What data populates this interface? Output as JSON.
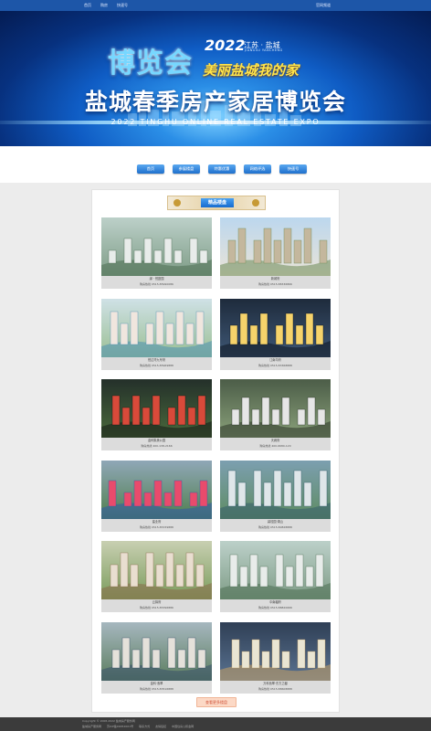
{
  "topbar": {
    "nav": [
      "首页",
      "购房",
      "快速号"
    ],
    "right_link": "官网频道"
  },
  "banner": {
    "expo_word": "博览会",
    "year": "2022",
    "city": "江苏 · 盐城",
    "city_en": "JIANGSU YANCHENG",
    "slogan": "美丽盐城我的家",
    "main_title": "盐城春季房产家居博览会",
    "subtitle": "2022 TINGHU ONLINE REAL ESTATE EXPO"
  },
  "tabs": [
    "首页",
    "参展楼盘",
    "特惠优惠",
    "网络评选",
    "快速号"
  ],
  "section": {
    "title": "精品楼盘"
  },
  "properties": [
    {
      "name": "绿 · 悦庭园",
      "phone": "购房热线 0515-85990086",
      "theme": "aerial-green"
    },
    {
      "name": "新城府",
      "phone": "购房热线 0515-88336866",
      "theme": "towers"
    },
    {
      "name": "悦达湾九号府",
      "phone": "购房热线 0515-85969888",
      "theme": "plan"
    },
    {
      "name": "江南华府",
      "phone": "购房热线 0515-83368888",
      "theme": "night"
    },
    {
      "name": "金科集美公园",
      "phone": "购房热线 400-138-2166",
      "theme": "night-green"
    },
    {
      "name": "天阙府",
      "phone": "购房热线 400-6680-120",
      "theme": "aerial-dark"
    },
    {
      "name": "建业府",
      "phone": "购房热线 0515-85339888",
      "theme": "colorful"
    },
    {
      "name": "碧桂园·湖山",
      "phone": "购房热线 0515-80828888",
      "theme": "lake"
    },
    {
      "name": "云锦府",
      "phone": "购房热线 0515-85396886",
      "theme": "sunset"
    },
    {
      "name": "中南樾府",
      "phone": "购房热线 0515-88820666",
      "theme": "aerial-green"
    },
    {
      "name": "金科·翡翠",
      "phone": "购房热线 0515-83516888",
      "theme": "river"
    },
    {
      "name": "万科翡翠·东方之樾",
      "phone": "购房热线 0515-88608888",
      "theme": "dusk"
    }
  ],
  "more_button": "查看更多楼盘",
  "footer": {
    "copyright": "Copyright © 2008-2022 盐城房产服务网",
    "links": [
      "盐城房产服务网",
      "苏ICP备09052001号",
      "联系方式",
      "友情链接",
      "中国住房公积金网"
    ]
  }
}
